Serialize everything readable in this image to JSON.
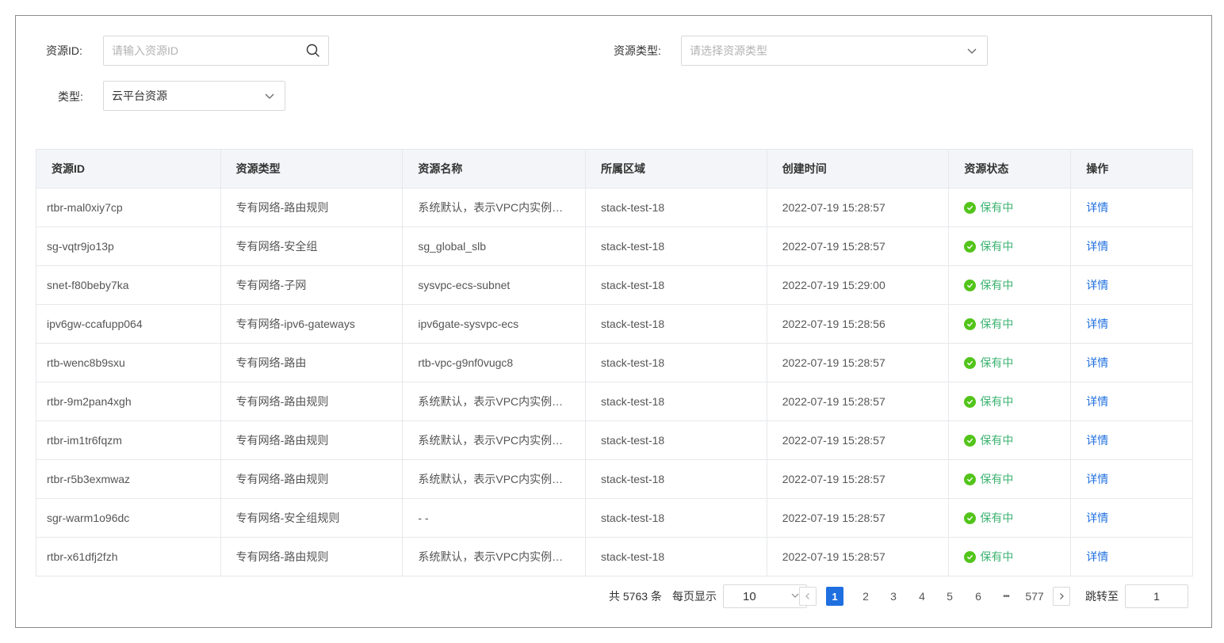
{
  "filters": {
    "resource_id_label": "资源ID:",
    "resource_id_placeholder": "请输入资源ID",
    "resource_type_label": "资源类型:",
    "resource_type_placeholder": "请选择资源类型",
    "type_label": "类型:",
    "type_value": "云平台资源"
  },
  "table": {
    "columns": [
      "资源ID",
      "资源类型",
      "资源名称",
      "所属区域",
      "创建时间",
      "资源状态",
      "操作"
    ],
    "rows": [
      {
        "id": "rtbr-mal0xiy7cp",
        "type": "专有网络-路由规则",
        "name": "系统默认，表示VPC内实例…",
        "region": "stack-test-18",
        "created": "2022-07-19 15:28:57",
        "status": "保有中",
        "action": "详情"
      },
      {
        "id": "sg-vqtr9jo13p",
        "type": "专有网络-安全组",
        "name": "sg_global_slb",
        "region": "stack-test-18",
        "created": "2022-07-19 15:28:57",
        "status": "保有中",
        "action": "详情"
      },
      {
        "id": "snet-f80beby7ka",
        "type": "专有网络-子网",
        "name": "sysvpc-ecs-subnet",
        "region": "stack-test-18",
        "created": "2022-07-19 15:29:00",
        "status": "保有中",
        "action": "详情"
      },
      {
        "id": "ipv6gw-ccafupp064",
        "type": "专有网络-ipv6-gateways",
        "name": "ipv6gate-sysvpc-ecs",
        "region": "stack-test-18",
        "created": "2022-07-19 15:28:56",
        "status": "保有中",
        "action": "详情"
      },
      {
        "id": "rtb-wenc8b9sxu",
        "type": "专有网络-路由",
        "name": "rtb-vpc-g9nf0vugc8",
        "region": "stack-test-18",
        "created": "2022-07-19 15:28:57",
        "status": "保有中",
        "action": "详情"
      },
      {
        "id": "rtbr-9m2pan4xgh",
        "type": "专有网络-路由规则",
        "name": "系统默认，表示VPC内实例…",
        "region": "stack-test-18",
        "created": "2022-07-19 15:28:57",
        "status": "保有中",
        "action": "详情"
      },
      {
        "id": "rtbr-im1tr6fqzm",
        "type": "专有网络-路由规则",
        "name": "系统默认，表示VPC内实例…",
        "region": "stack-test-18",
        "created": "2022-07-19 15:28:57",
        "status": "保有中",
        "action": "详情"
      },
      {
        "id": "rtbr-r5b3exmwaz",
        "type": "专有网络-路由规则",
        "name": "系统默认，表示VPC内实例…",
        "region": "stack-test-18",
        "created": "2022-07-19 15:28:57",
        "status": "保有中",
        "action": "详情"
      },
      {
        "id": "sgr-warm1o96dc",
        "type": "专有网络-安全组规则",
        "name": "- -",
        "region": "stack-test-18",
        "created": "2022-07-19 15:28:57",
        "status": "保有中",
        "action": "详情"
      },
      {
        "id": "rtbr-x61dfj2fzh",
        "type": "专有网络-路由规则",
        "name": "系统默认，表示VPC内实例…",
        "region": "stack-test-18",
        "created": "2022-07-19 15:28:57",
        "status": "保有中",
        "action": "详情"
      }
    ]
  },
  "pagination": {
    "total_text": "共 5763 条",
    "per_page_label": "每页显示",
    "per_page_value": "10",
    "pages": [
      "1",
      "2",
      "3",
      "4",
      "5",
      "6"
    ],
    "ellipsis": "•••",
    "last_page": "577",
    "jump_label": "跳转至",
    "jump_value": "1"
  },
  "colors": {
    "primary": "#1f6fe0",
    "status_green": "#52c41a",
    "header_bg": "#f3f5f8"
  }
}
